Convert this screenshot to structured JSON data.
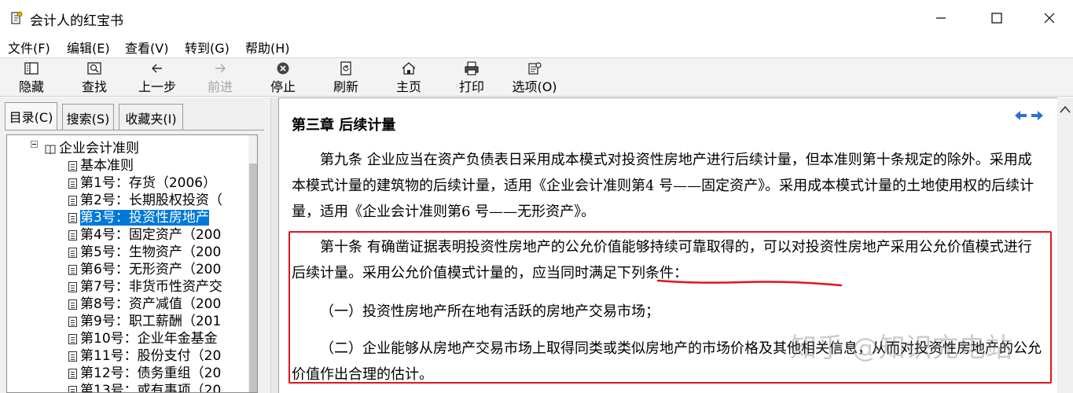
{
  "window": {
    "title": "会计人的红宝书"
  },
  "menu": [
    {
      "label": "文件(F)"
    },
    {
      "label": "编辑(E)"
    },
    {
      "label": "查看(V)"
    },
    {
      "label": "转到(G)"
    },
    {
      "label": "帮助(H)"
    }
  ],
  "toolbar": [
    {
      "label": "隐藏",
      "icon": "hide-icon",
      "enabled": true
    },
    {
      "label": "查找",
      "icon": "find-icon",
      "enabled": true
    },
    {
      "label": "上一步",
      "icon": "back-arrow-icon",
      "enabled": true
    },
    {
      "label": "前进",
      "icon": "forward-arrow-icon",
      "enabled": false
    },
    {
      "label": "停止",
      "icon": "stop-icon",
      "enabled": true
    },
    {
      "label": "刷新",
      "icon": "refresh-icon",
      "enabled": true
    },
    {
      "label": "主页",
      "icon": "home-icon",
      "enabled": true
    },
    {
      "label": "打印",
      "icon": "print-icon",
      "enabled": true
    },
    {
      "label": "选项(O)",
      "icon": "options-icon",
      "enabled": true
    }
  ],
  "tabs": [
    {
      "label": "目录(C)",
      "active": true
    },
    {
      "label": "搜索(S)",
      "active": false
    },
    {
      "label": "收藏夹(I)",
      "active": false
    }
  ],
  "tree": {
    "root": "企业会计准则",
    "items": [
      {
        "label": "基本准则",
        "selected": false
      },
      {
        "label": "第1号：存货（2006）",
        "selected": false
      },
      {
        "label": "第2号：长期股权投资（",
        "selected": false
      },
      {
        "label": "第3号：投资性房地产",
        "selected": true
      },
      {
        "label": "第4号：固定资产（200",
        "selected": false
      },
      {
        "label": "第5号：生物资产（200",
        "selected": false
      },
      {
        "label": "第6号：无形资产（200",
        "selected": false
      },
      {
        "label": "第7号：非货币性资产交",
        "selected": false
      },
      {
        "label": "第8号：资产减值（200",
        "selected": false
      },
      {
        "label": "第9号：职工薪酬（201",
        "selected": false
      },
      {
        "label": "第10号：企业年金基金",
        "selected": false
      },
      {
        "label": "第11号：股份支付（20",
        "selected": false
      },
      {
        "label": "第12号：债务重组（20",
        "selected": false
      },
      {
        "label": "第13号：或有事项（20",
        "selected": false
      }
    ]
  },
  "content": {
    "chapter_title": "第三章  后续计量",
    "paragraphs": [
      "第九条  企业应当在资产负债表日采用成本模式对投资性房地产进行后续计量，但本准则第十条规定的除外。采用成本模式计量的建筑物的后续计量，适用《企业会计准则第4 号——固定资产》。采用成本模式计量的土地使用权的后续计量，适用《企业会计准则第6 号——无形资产》。",
      "第十条  有确凿证据表明投资性房地产的公允价值能够持续可靠取得的，可以对投资性房地产采用公允价值模式进行后续计量。采用公允价值模式计量的，应当同时满足下列条件：",
      "（一）投资性房地产所在地有活跃的房地产交易市场；",
      "（二）企业能够从房地产交易市场上取得同类或类似房地产的市场价格及其他相关信息，从而对投资性房地产的公允价值作出合理的估计。"
    ],
    "watermark": "知乎 @知识充电站"
  },
  "colors": {
    "highlight_box": "#e0151f",
    "selection": "#0078d7",
    "nav_arrows": "#2f6fd6"
  }
}
